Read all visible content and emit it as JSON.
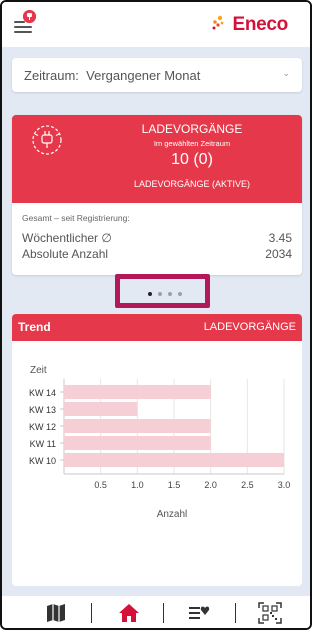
{
  "app": {
    "brand": "Eneco",
    "notification_count": ""
  },
  "filter": {
    "label": "Zeitraum:",
    "value": "Vergangener Monat"
  },
  "summary_card": {
    "title": "LADEVORGÄNGE",
    "subtitle": "Im gewählten Zeitraum",
    "count": "10 (0)",
    "active_label": "LADEVORGÄNGE (AKTIVE)",
    "total_heading": "Gesamt – seit Registrierung:",
    "rows": [
      {
        "label": "Wöchentlicher ∅",
        "value": "3.45"
      },
      {
        "label": "Absolute Anzahl",
        "value": "2034"
      }
    ]
  },
  "pager": {
    "count": 4,
    "active_index": 0
  },
  "trend": {
    "title": "Trend",
    "metric": "LADEVORGÄNGE"
  },
  "chart_data": {
    "type": "bar",
    "orientation": "horizontal",
    "ylabel": "Zeit",
    "xlabel": "Anzahl",
    "categories": [
      "KW 14",
      "KW 13",
      "KW 12",
      "KW 11",
      "KW 10"
    ],
    "values": [
      2,
      1,
      2,
      2,
      3
    ],
    "xticks": [
      "0.5",
      "1.0",
      "1.5",
      "2.0",
      "2.5",
      "3.0"
    ],
    "xlim": [
      0,
      3
    ],
    "bar_color": "#f6cfd6",
    "grid": true
  },
  "colors": {
    "accent": "#e5384a",
    "brand": "#d5113a",
    "background": "#e3e9f3",
    "highlight_frame": "#b3185a"
  },
  "nav": [
    {
      "icon": "map-icon"
    },
    {
      "icon": "home-icon",
      "active": true
    },
    {
      "icon": "charging-list-icon"
    },
    {
      "icon": "qr-code-icon"
    }
  ]
}
